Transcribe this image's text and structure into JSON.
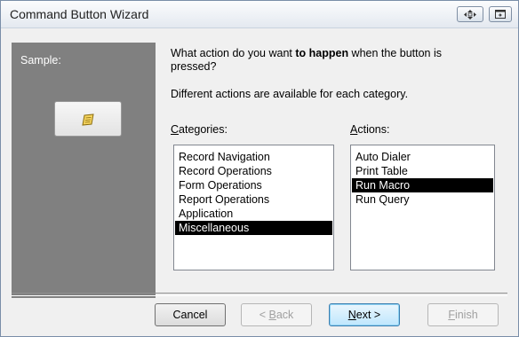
{
  "window": {
    "title": "Command Button Wizard"
  },
  "sample": {
    "label": "Sample:"
  },
  "prompt": {
    "line1_pre": "What action do you want ",
    "line1_bold": "to happen",
    "line1_post": " when the button is",
    "line2": "pressed?",
    "note": "Different actions are available for each category."
  },
  "categories": {
    "label_ul": "C",
    "label_rest": "ategories:",
    "items": [
      "Record Navigation",
      "Record Operations",
      "Form Operations",
      "Report Operations",
      "Application",
      "Miscellaneous"
    ],
    "selected": "Miscellaneous"
  },
  "actions": {
    "label_ul": "A",
    "label_rest": "ctions:",
    "items": [
      "Auto Dialer",
      "Print Table",
      "Run Macro",
      "Run Query"
    ],
    "selected": "Run Macro"
  },
  "buttons": {
    "cancel": "Cancel",
    "back_pre": "< ",
    "back_ul": "B",
    "back_rest": "ack",
    "next_ul": "N",
    "next_rest": "ext >",
    "finish_ul": "F",
    "finish_rest": "inish"
  }
}
